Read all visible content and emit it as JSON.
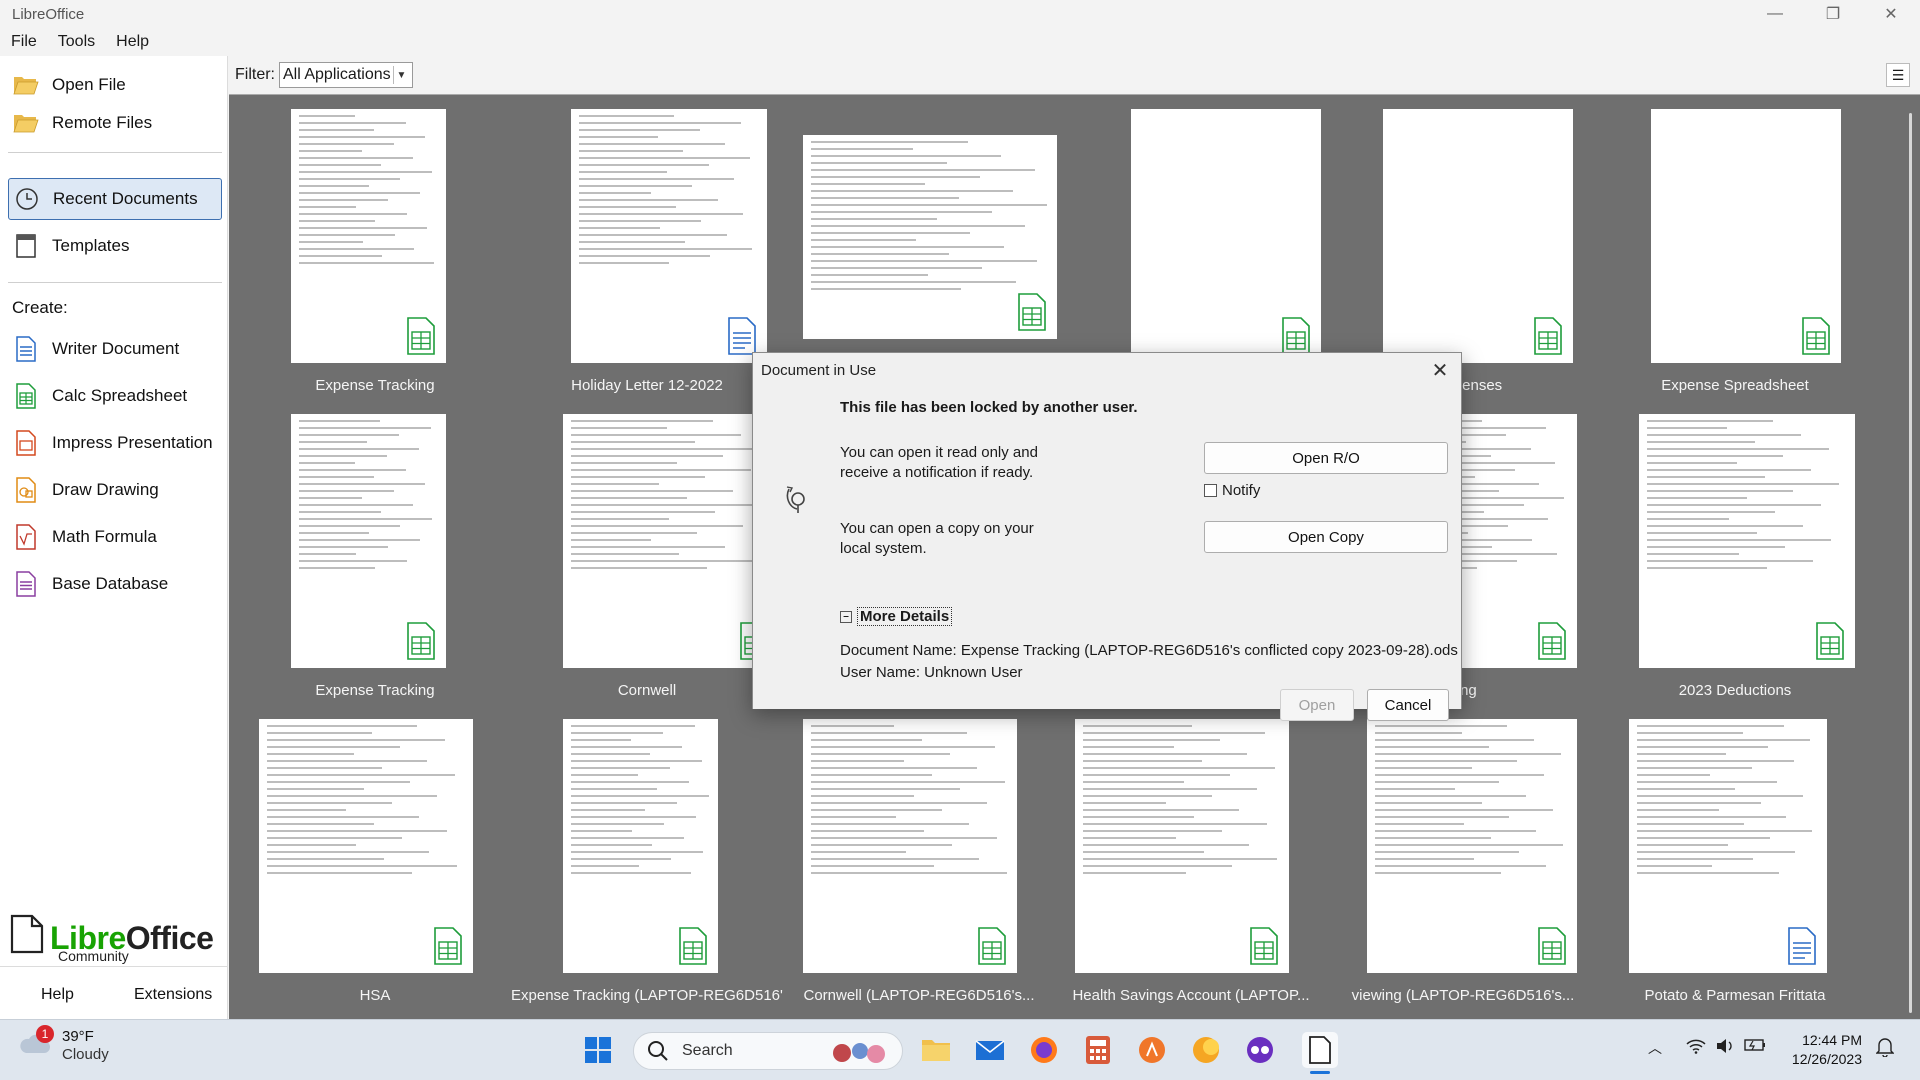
{
  "window": {
    "title": "LibreOffice"
  },
  "menu": {
    "file": "File",
    "tools": "Tools",
    "help": "Help"
  },
  "sidebar": {
    "open_file": "Open File",
    "remote_files": "Remote Files",
    "recent_documents": "Recent Documents",
    "templates": "Templates",
    "create_heading": "Create:",
    "create": [
      {
        "label": "Writer Document",
        "icon": "writer-icon",
        "color": "#2a6bc6"
      },
      {
        "label": "Calc Spreadsheet",
        "icon": "calc-icon",
        "color": "#1e9d3b"
      },
      {
        "label": "Impress Presentation",
        "icon": "impress-icon",
        "color": "#d4491e"
      },
      {
        "label": "Draw Drawing",
        "icon": "draw-icon",
        "color": "#e08b14"
      },
      {
        "label": "Math Formula",
        "icon": "math-icon",
        "color": "#c0392b"
      },
      {
        "label": "Base Database",
        "icon": "base-icon",
        "color": "#8a3fa0"
      }
    ],
    "logo_name_a": "Libre",
    "logo_name_b": "Office",
    "logo_sub": "Community",
    "help": "Help",
    "extensions": "Extensions"
  },
  "filter": {
    "label": "Filter:",
    "value": "All Applications"
  },
  "documents": [
    {
      "caption": "Expense Tracking",
      "type": "calc"
    },
    {
      "caption": "Holiday Letter 12-2022",
      "type": "writer"
    },
    {
      "caption": "",
      "type": "calc"
    },
    {
      "caption": "",
      "type": "calc"
    },
    {
      "caption": "e Expenses",
      "type": "calc"
    },
    {
      "caption": "Expense Spreadsheet",
      "type": "calc"
    },
    {
      "caption": "Expense Tracking",
      "type": "calc"
    },
    {
      "caption": "Cornwell",
      "type": "calc"
    },
    {
      "caption": "",
      "type": "calc"
    },
    {
      "caption": "",
      "type": "calc"
    },
    {
      "caption": "ving",
      "type": "calc"
    },
    {
      "caption": "2023 Deductions",
      "type": "calc"
    },
    {
      "caption": "HSA",
      "type": "calc"
    },
    {
      "caption": "Expense Tracking (LAPTOP-REG6D516'...",
      "type": "calc"
    },
    {
      "caption": "Cornwell (LAPTOP-REG6D516's...",
      "type": "calc"
    },
    {
      "caption": "Health Savings Account (LAPTOP...",
      "type": "calc"
    },
    {
      "caption": "viewing (LAPTOP-REG6D516's...",
      "type": "calc"
    },
    {
      "caption": "Potato & Parmesan Frittata",
      "type": "writer"
    }
  ],
  "dialog": {
    "title": "Document in Use",
    "heading": "This file has been locked by another user.",
    "ro_text_1": "You can open it read only  and",
    "ro_text_2": "receive a notification if ready.",
    "copy_text_1": "You can open a copy on your",
    "copy_text_2": "local system.",
    "open_ro": "Open R/O",
    "notify": "Notify",
    "open_copy": "Open Copy",
    "more_details": "More Details",
    "doc_name": "Document Name: Expense Tracking (LAPTOP-REG6D516's conflicted copy 2023-09-28).ods",
    "user_name": "User Name: Unknown User",
    "open": "Open",
    "cancel": "Cancel"
  },
  "taskbar": {
    "weather_badge": "1",
    "temperature": "39°F",
    "condition": "Cloudy",
    "search_placeholder": "Search",
    "time": "12:44 PM",
    "date": "12/26/2023"
  }
}
